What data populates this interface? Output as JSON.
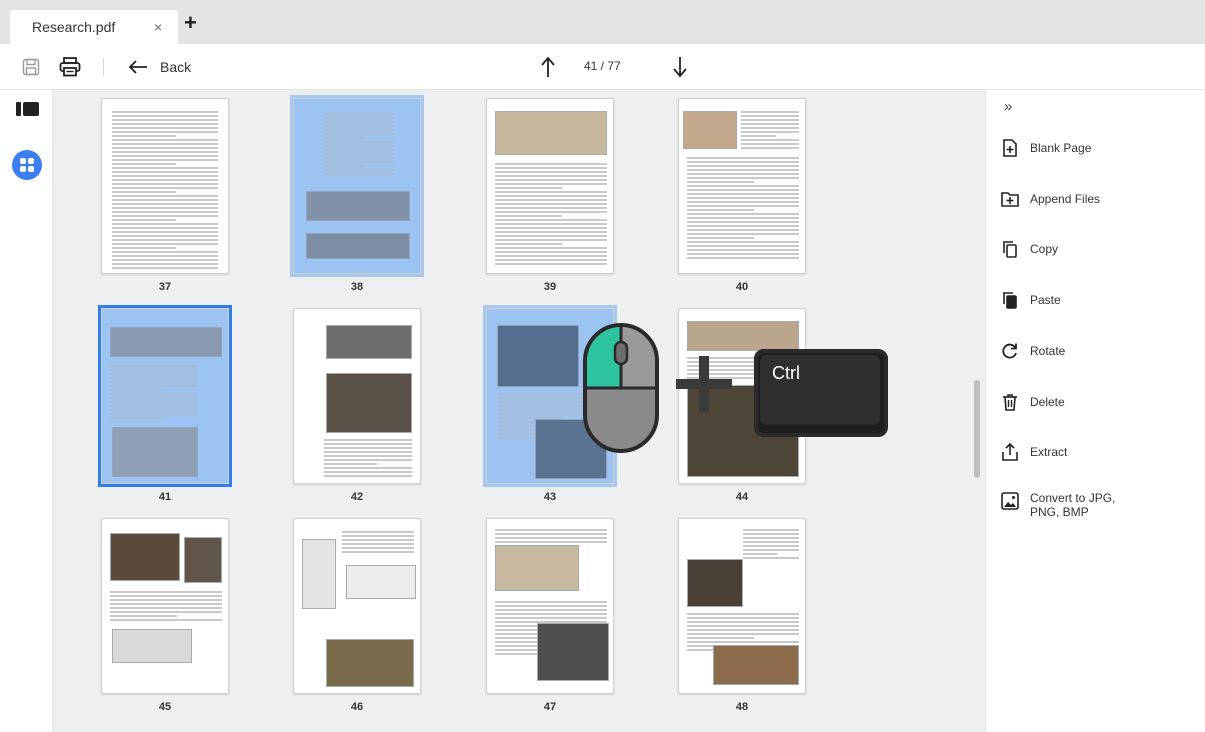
{
  "tab": {
    "title": "Research.pdf",
    "close": "×",
    "add": "+"
  },
  "toolbar": {
    "back_label": "Back",
    "page_indicator": "41 / 77"
  },
  "pages": [
    {
      "num": "37",
      "selected": false,
      "active": false,
      "layout": "text"
    },
    {
      "num": "38",
      "selected": true,
      "active": false,
      "layout": "twoimg"
    },
    {
      "num": "39",
      "selected": false,
      "active": false,
      "layout": "topimg"
    },
    {
      "num": "40",
      "selected": false,
      "active": false,
      "layout": "topleftimg"
    },
    {
      "num": "41",
      "selected": true,
      "active": true,
      "layout": "map"
    },
    {
      "num": "42",
      "selected": false,
      "active": false,
      "layout": "photos"
    },
    {
      "num": "43",
      "selected": true,
      "active": false,
      "layout": "photos2"
    },
    {
      "num": "44",
      "selected": false,
      "active": false,
      "layout": "photos3"
    },
    {
      "num": "45",
      "selected": false,
      "active": false,
      "layout": "arch"
    },
    {
      "num": "46",
      "selected": false,
      "active": false,
      "layout": "diagram"
    },
    {
      "num": "47",
      "selected": false,
      "active": false,
      "layout": "photos4"
    },
    {
      "num": "48",
      "selected": false,
      "active": false,
      "layout": "photos5"
    }
  ],
  "right_panel": {
    "collapse": "»",
    "items": [
      {
        "label": "Blank Page",
        "icon": "blank-page-icon"
      },
      {
        "label": "Append Files",
        "icon": "append-files-icon"
      },
      {
        "label": "Copy",
        "icon": "copy-icon"
      },
      {
        "label": "Paste",
        "icon": "paste-icon"
      },
      {
        "label": "Rotate",
        "icon": "rotate-icon"
      },
      {
        "label": "Delete",
        "icon": "delete-icon"
      },
      {
        "label": "Extract",
        "icon": "extract-icon"
      },
      {
        "label": "Convert to JPG,\nPNG, BMP",
        "icon": "convert-icon"
      }
    ]
  },
  "overlay": {
    "key_label": "Ctrl"
  },
  "colors": {
    "accent": "#3c7ff0",
    "selection": "#b8d4f7",
    "mouse_button": "#2ec4a0"
  }
}
